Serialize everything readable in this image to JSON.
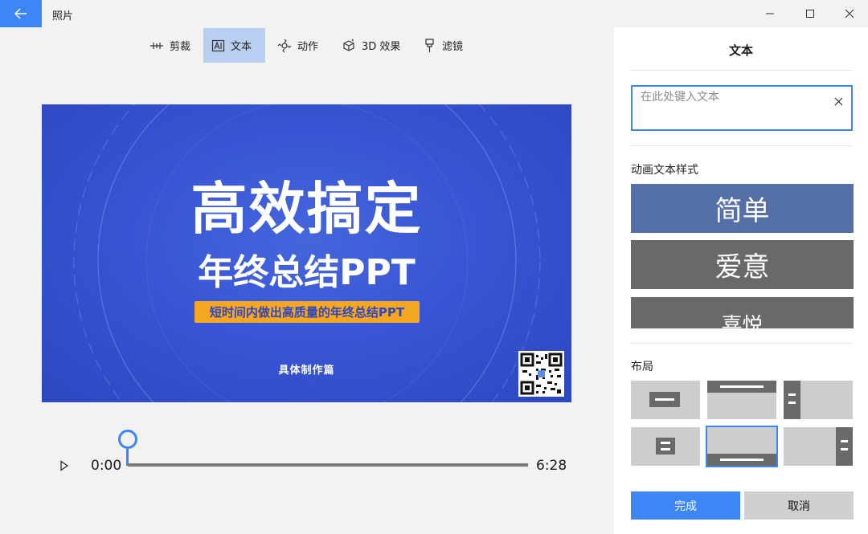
{
  "titlebar": {
    "app_title": "照片"
  },
  "toolbar": {
    "items": [
      {
        "label": "剪裁",
        "icon": "crop-icon"
      },
      {
        "label": "文本",
        "icon": "text-icon",
        "active": true
      },
      {
        "label": "动作",
        "icon": "motion-icon"
      },
      {
        "label": "3D 效果",
        "icon": "3d-effects-icon"
      },
      {
        "label": "滤镜",
        "icon": "filter-icon"
      }
    ]
  },
  "preview": {
    "headline_line1": "高效搞定",
    "headline_line2": "年终总结PPT",
    "tagline": "短时间内做出高质量的年终总结PPT",
    "subline": "具体制作篇"
  },
  "timeline": {
    "current_time": "0:00",
    "total_time": "6:28",
    "progress": 0.0
  },
  "panel": {
    "title": "文本",
    "input_placeholder": "在此处键入文本",
    "input_value": "",
    "styles_label": "动画文本样式",
    "styles": [
      {
        "label": "简单",
        "color": "#5470a6"
      },
      {
        "label": "爱意",
        "color": "#696969"
      },
      {
        "label": "喜悦",
        "color": "#696969"
      }
    ],
    "layout_label": "布局",
    "done_label": "完成",
    "cancel_label": "取消"
  },
  "colors": {
    "accent": "#3d86f5",
    "toolbar_active": "#b8cff2",
    "slide_blue": "#3955d3",
    "tagline_yellow": "#f5a623"
  }
}
